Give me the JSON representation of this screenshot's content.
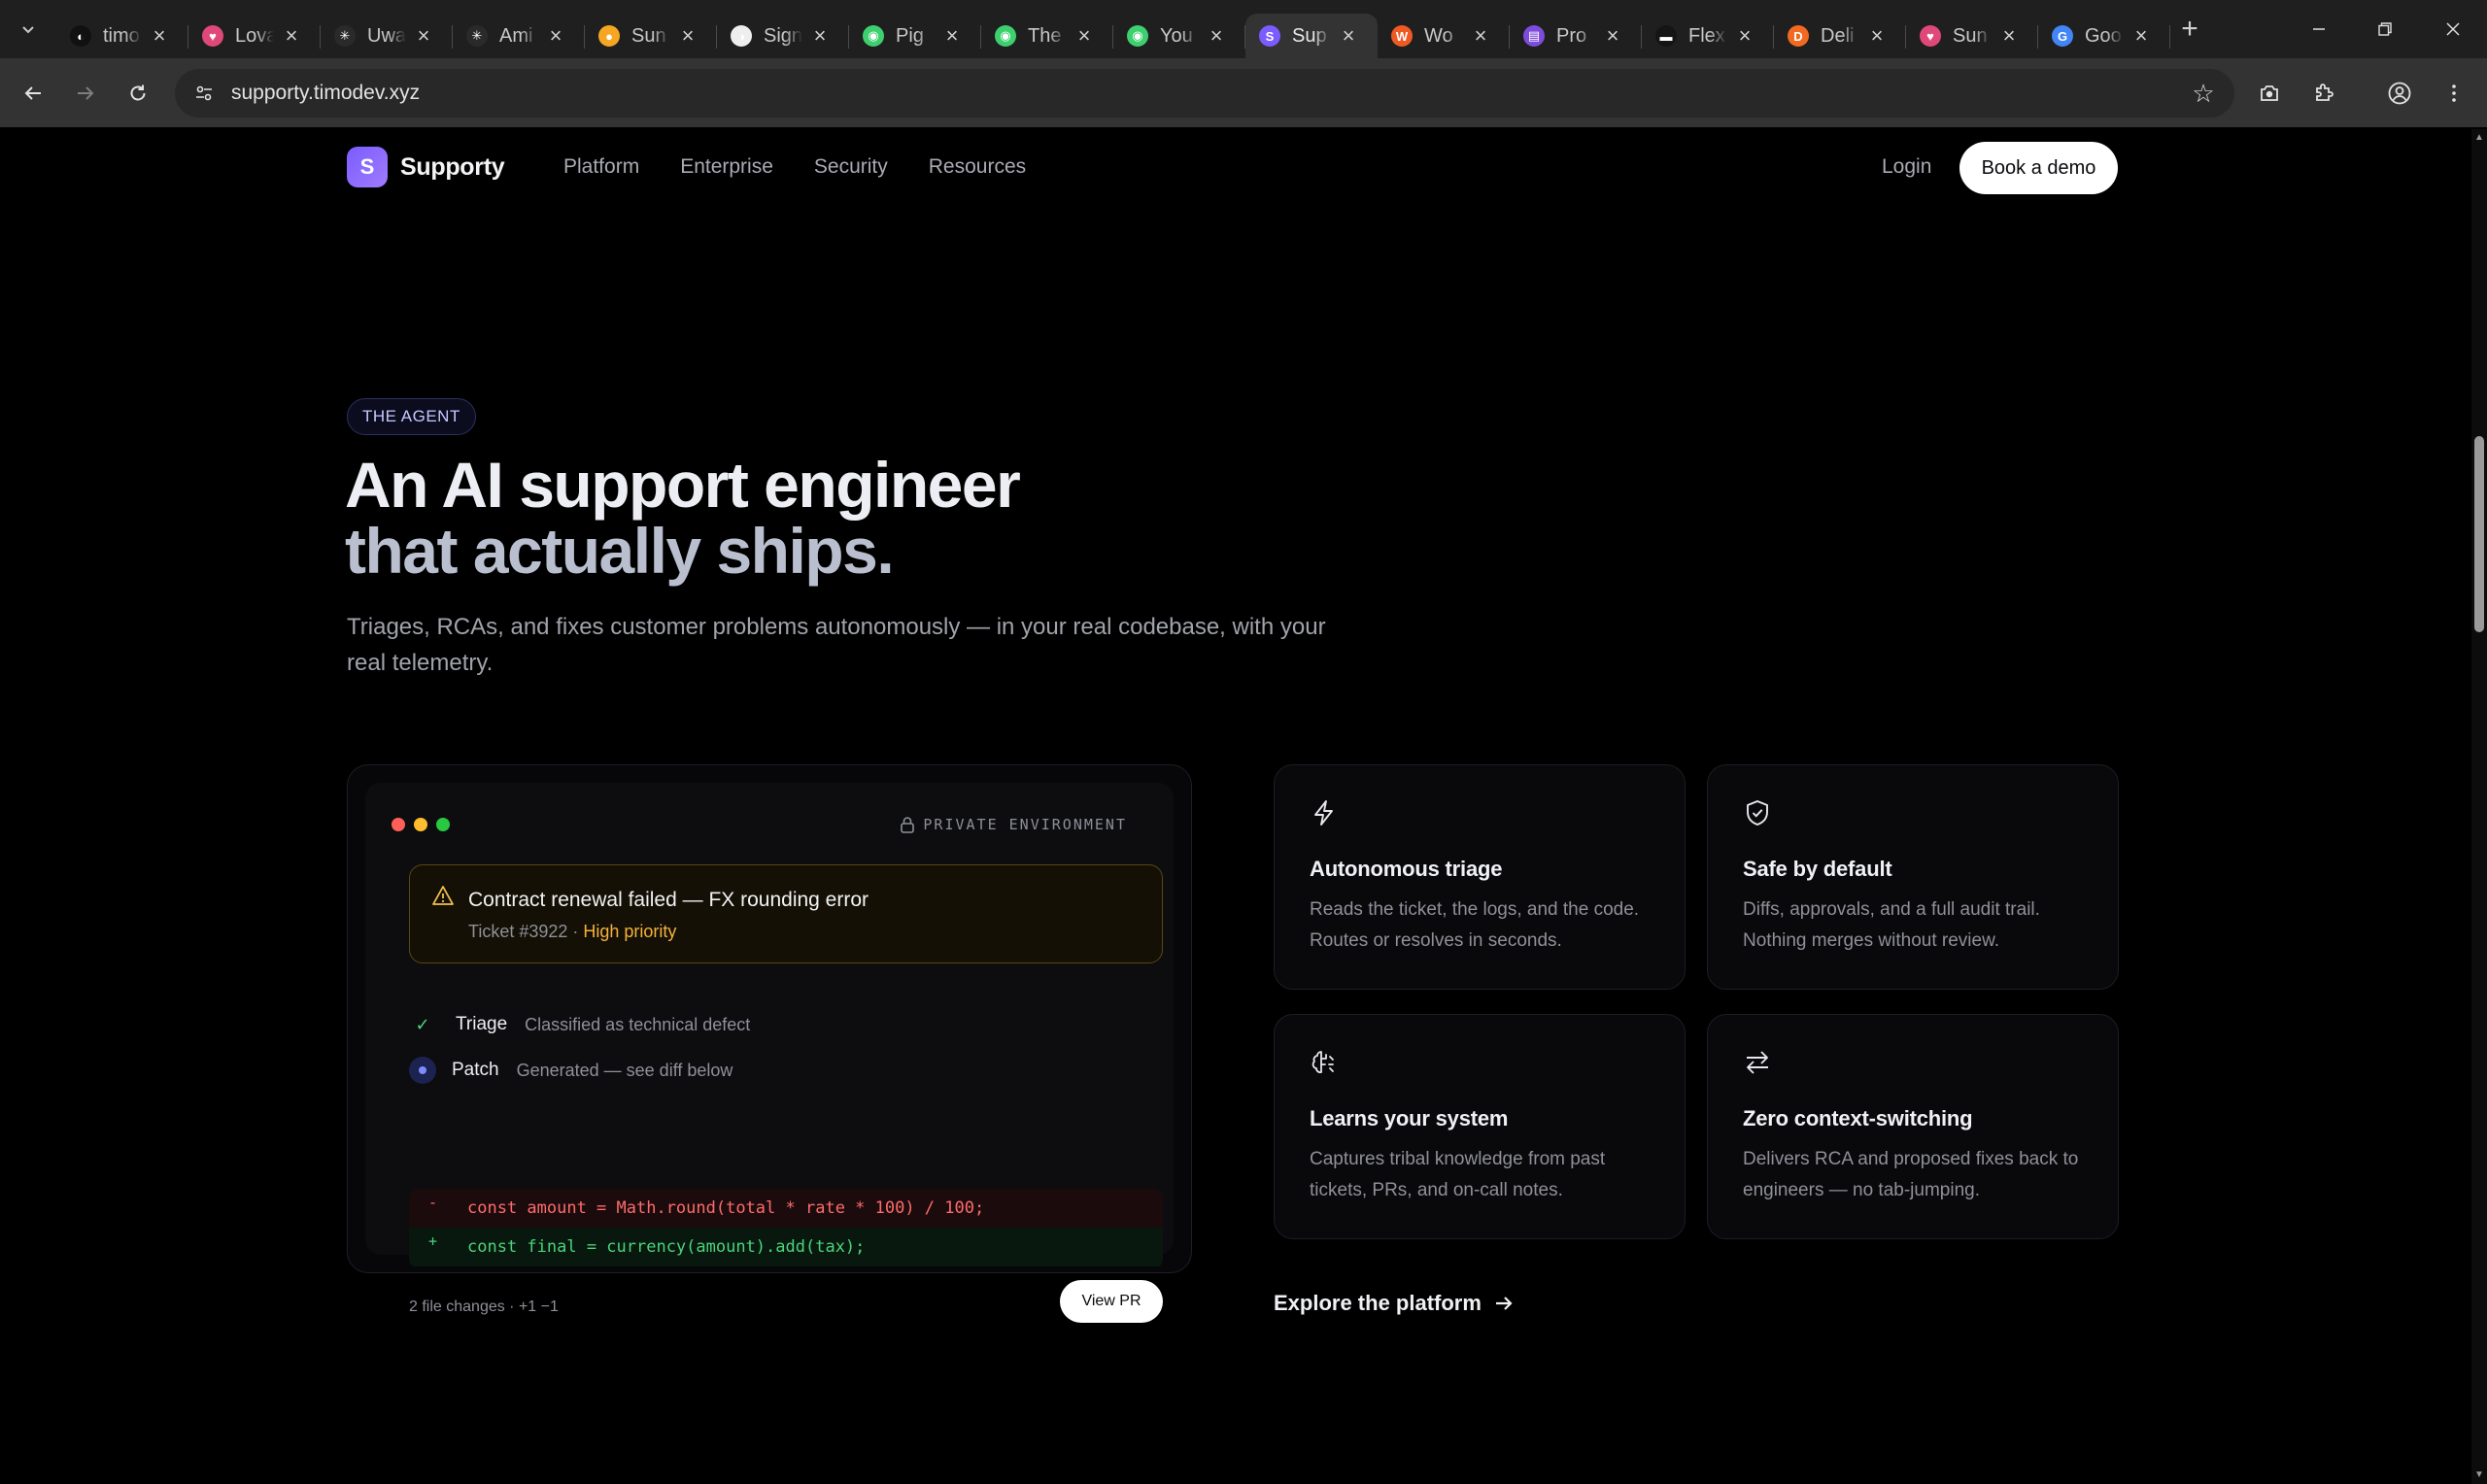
{
  "browser": {
    "tabs": [
      {
        "title": "timo",
        "color": "#111111",
        "glyph": "◐",
        "active": false
      },
      {
        "title": "Lovable",
        "color": "#e0487a",
        "glyph": "♥",
        "active": false
      },
      {
        "title": "Uwa",
        "color": "#2a2a2a",
        "glyph": "✳",
        "active": false
      },
      {
        "title": "Ami",
        "color": "#2a2a2a",
        "glyph": "✳",
        "active": false
      },
      {
        "title": "Sun",
        "color": "#f5a623",
        "glyph": "●",
        "active": false
      },
      {
        "title": "Sign",
        "color": "#eeeeee",
        "glyph": "◑",
        "active": false
      },
      {
        "title": "Pig",
        "color": "#3ecf6e",
        "glyph": "◉",
        "active": false
      },
      {
        "title": "The",
        "color": "#3ecf6e",
        "glyph": "◉",
        "active": false
      },
      {
        "title": "You",
        "color": "#3ecf6e",
        "glyph": "◉",
        "active": false
      },
      {
        "title": "Sup",
        "color": "#7a5cff",
        "glyph": "S",
        "active": true
      },
      {
        "title": "Wo",
        "color": "#ef5a24",
        "glyph": "W",
        "active": false
      },
      {
        "title": "Pro",
        "color": "#7d4cdb",
        "glyph": "▤",
        "active": false
      },
      {
        "title": "Flex",
        "color": "#151515",
        "glyph": "▬",
        "active": false
      },
      {
        "title": "Deli",
        "color": "#f26a21",
        "glyph": "D",
        "active": false
      },
      {
        "title": "Sun",
        "color": "#e0487a",
        "glyph": "♥",
        "active": false
      },
      {
        "title": "Goo",
        "color": "#4285f4",
        "glyph": "G",
        "active": false
      }
    ],
    "url": "supporty.timodev.xyz"
  },
  "nav": {
    "brand_initial": "S",
    "brand_name": "Supporty",
    "links": [
      "Platform",
      "Enterprise",
      "Security",
      "Resources"
    ],
    "login": "Login",
    "cta": "Book a demo"
  },
  "hero": {
    "eyebrow": "THE AGENT",
    "headline_line1": "An AI support engineer",
    "headline_line2": "that actually ships.",
    "subtitle": "Triages, RCAs, and fixes customer problems autonomously — in your real codebase, with your real telemetry."
  },
  "terminal": {
    "env_label": "PRIVATE ENVIRONMENT",
    "alert_title": "Contract renewal failed — FX rounding error",
    "ticket": "Ticket #3922 · ",
    "priority": "High priority",
    "steps": [
      {
        "name": "Triage",
        "desc": "Classified as technical defect",
        "status": "done"
      },
      {
        "name": "Patch",
        "desc": "Generated — see diff below",
        "status": "active"
      }
    ],
    "diff": [
      {
        "sign": "-",
        "code": "const amount = Math.round(total * rate * 100) / 100;",
        "kind": "del"
      },
      {
        "sign": "+",
        "code": "const final = currency(amount).add(tax);",
        "kind": "add"
      }
    ],
    "footer": "2 file changes · +1 −1",
    "button": "View PR"
  },
  "features": [
    {
      "icon": "lightning-icon",
      "title": "Autonomous triage",
      "desc": "Reads the ticket, the logs, and the code. Routes or resolves in seconds."
    },
    {
      "icon": "shield-check-icon",
      "title": "Safe by default",
      "desc": "Diffs, approvals, and a full audit trail. Nothing merges without review."
    },
    {
      "icon": "brain-icon",
      "title": "Learns your system",
      "desc": "Captures tribal knowledge from past tickets, PRs, and on-call notes."
    },
    {
      "icon": "arrows-swap-icon",
      "title": "Zero context-switching",
      "desc": "Delivers RCA and proposed fixes back to engineers — no tab-jumping."
    }
  ],
  "explore": "Explore the platform"
}
